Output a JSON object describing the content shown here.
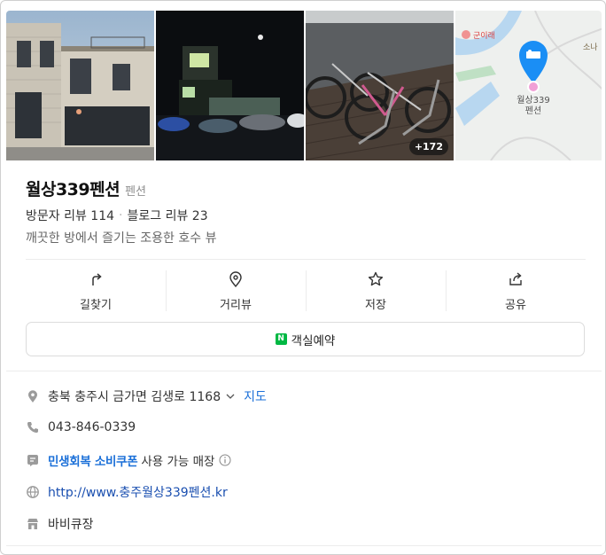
{
  "photos": {
    "more_count": "+172",
    "map_label_place": "월상339",
    "map_label_place2": "펜션",
    "map_label_left": "군이래",
    "map_label_right": "소나"
  },
  "place": {
    "name": "월상339펜션",
    "category": "펜션",
    "visitor_reviews": "방문자 리뷰 114",
    "blog_reviews": "블로그 리뷰 23",
    "description": "깨끗한 방에서 즐기는 조용한 호수 뷰"
  },
  "actions": [
    {
      "label": "길찾기",
      "icon": "directions-icon"
    },
    {
      "label": "거리뷰",
      "icon": "street-view-icon"
    },
    {
      "label": "저장",
      "icon": "star-icon"
    },
    {
      "label": "공유",
      "icon": "share-icon"
    }
  ],
  "booking": {
    "badge": "N",
    "label": "객실예약"
  },
  "details": {
    "address": "충북 충주시 금가면 김생로 1168",
    "map_link": "지도",
    "phone": "043-846-0339",
    "coupon": "민생회복 소비쿠폰",
    "coupon_rest": "사용 가능 매장",
    "homepage": "http://www.충주월상339펜션.kr",
    "facility": "바비큐장"
  },
  "colors": {
    "accent": "#1a6fd8",
    "naver_green": "#00b843",
    "map_pin": "#1a8ef5"
  }
}
